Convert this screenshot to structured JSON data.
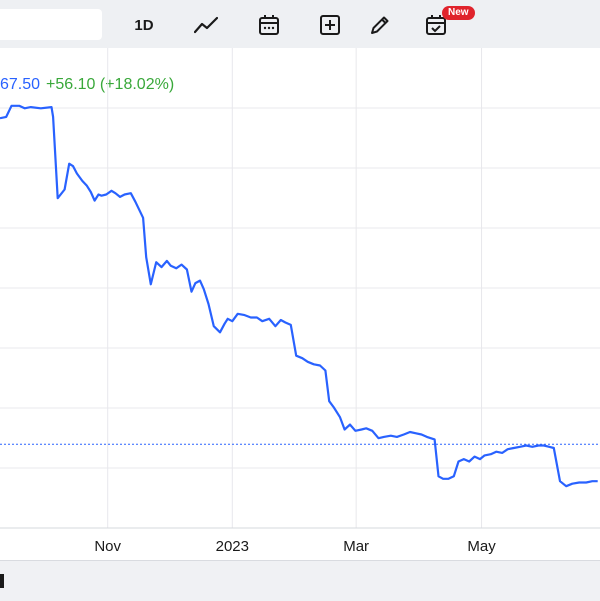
{
  "toolbar": {
    "interval_label": "1D",
    "new_badge": "New",
    "icons": [
      "line-chart-icon",
      "calendar-icon",
      "add-compare-icon",
      "pencil-icon",
      "calendar-check-icon"
    ]
  },
  "price": {
    "value": "67.50",
    "change": "+56.10 (+18.02%)"
  },
  "colors": {
    "line": "#2962ff",
    "positive": "#39a83a",
    "badge": "#e0242c",
    "grid": "#e8e8ec"
  },
  "chart_data": {
    "type": "line",
    "x_tick_labels": [
      "Nov",
      "2023",
      "Mar",
      "May"
    ],
    "grid": true,
    "reference_line": "dotted horizontal",
    "series": [
      {
        "values": [
          {
            "x": 0.0,
            "y": 0.83
          },
          {
            "x": 0.8,
            "y": 0.84
          },
          {
            "x": 1.5,
            "y": 0.93
          },
          {
            "x": 2.5,
            "y": 0.93
          },
          {
            "x": 3.2,
            "y": 0.91
          },
          {
            "x": 4.0,
            "y": 0.92
          },
          {
            "x": 5.3,
            "y": 0.91
          },
          {
            "x": 6.7,
            "y": 0.92
          },
          {
            "x": 6.9,
            "y": 0.84
          },
          {
            "x": 7.5,
            "y": 0.18
          },
          {
            "x": 8.4,
            "y": 0.25
          },
          {
            "x": 9.0,
            "y": 0.46
          },
          {
            "x": 9.5,
            "y": 0.44
          },
          {
            "x": 10.0,
            "y": 0.38
          },
          {
            "x": 10.7,
            "y": 0.32
          },
          {
            "x": 11.3,
            "y": 0.28
          },
          {
            "x": 11.8,
            "y": 0.23
          },
          {
            "x": 12.3,
            "y": 0.16
          },
          {
            "x": 12.8,
            "y": 0.21
          },
          {
            "x": 13.2,
            "y": 0.2
          },
          {
            "x": 13.8,
            "y": 0.21
          },
          {
            "x": 14.5,
            "y": 0.24
          },
          {
            "x": 15.0,
            "y": 0.22
          },
          {
            "x": 15.6,
            "y": 0.19
          },
          {
            "x": 16.2,
            "y": 0.21
          },
          {
            "x": 17.0,
            "y": 0.22
          },
          {
            "x": 17.6,
            "y": 0.15
          },
          {
            "x": 18.6,
            "y": 0.02
          },
          {
            "x": 19.0,
            "y": -0.3
          },
          {
            "x": 19.6,
            "y": -0.52
          },
          {
            "x": 20.3,
            "y": -0.34
          },
          {
            "x": 21.0,
            "y": -0.38
          },
          {
            "x": 21.7,
            "y": -0.33
          },
          {
            "x": 22.2,
            "y": -0.37
          },
          {
            "x": 22.9,
            "y": -0.39
          },
          {
            "x": 23.6,
            "y": -0.36
          },
          {
            "x": 24.3,
            "y": -0.4
          },
          {
            "x": 24.9,
            "y": -0.58
          },
          {
            "x": 25.4,
            "y": -0.51
          },
          {
            "x": 26.0,
            "y": -0.49
          },
          {
            "x": 26.5,
            "y": -0.56
          },
          {
            "x": 27.1,
            "y": -0.68
          },
          {
            "x": 27.8,
            "y": -0.86
          },
          {
            "x": 28.6,
            "y": -0.91
          },
          {
            "x": 29.2,
            "y": -0.84
          },
          {
            "x": 29.6,
            "y": -0.8
          },
          {
            "x": 30.2,
            "y": -0.82
          },
          {
            "x": 30.9,
            "y": -0.76
          },
          {
            "x": 31.8,
            "y": -0.77
          },
          {
            "x": 32.6,
            "y": -0.79
          },
          {
            "x": 33.4,
            "y": -0.79
          },
          {
            "x": 34.1,
            "y": -0.82
          },
          {
            "x": 35.0,
            "y": -0.8
          },
          {
            "x": 35.8,
            "y": -0.86
          },
          {
            "x": 36.5,
            "y": -0.81
          },
          {
            "x": 37.1,
            "y": -0.83
          },
          {
            "x": 37.8,
            "y": -0.85
          },
          {
            "x": 38.5,
            "y": -1.1
          },
          {
            "x": 39.3,
            "y": -1.12
          },
          {
            "x": 40.0,
            "y": -1.15
          },
          {
            "x": 40.8,
            "y": -1.17
          },
          {
            "x": 41.6,
            "y": -1.18
          },
          {
            "x": 42.3,
            "y": -1.22
          },
          {
            "x": 42.8,
            "y": -1.47
          },
          {
            "x": 43.4,
            "y": -1.52
          },
          {
            "x": 44.2,
            "y": -1.6
          },
          {
            "x": 44.8,
            "y": -1.7
          },
          {
            "x": 45.5,
            "y": -1.66
          },
          {
            "x": 46.2,
            "y": -1.71
          },
          {
            "x": 47.0,
            "y": -1.7
          },
          {
            "x": 47.6,
            "y": -1.69
          },
          {
            "x": 48.4,
            "y": -1.71
          },
          {
            "x": 49.2,
            "y": -1.77
          },
          {
            "x": 49.9,
            "y": -1.76
          },
          {
            "x": 50.8,
            "y": -1.75
          },
          {
            "x": 51.6,
            "y": -1.76
          },
          {
            "x": 52.5,
            "y": -1.74
          },
          {
            "x": 53.3,
            "y": -1.72
          },
          {
            "x": 54.0,
            "y": -1.73
          },
          {
            "x": 54.8,
            "y": -1.74
          },
          {
            "x": 55.5,
            "y": -1.76
          },
          {
            "x": 56.5,
            "y": -1.78
          },
          {
            "x": 57.0,
            "y": -2.08
          },
          {
            "x": 57.6,
            "y": -2.1
          },
          {
            "x": 58.3,
            "y": -2.1
          },
          {
            "x": 59.0,
            "y": -2.08
          },
          {
            "x": 59.6,
            "y": -1.96
          },
          {
            "x": 60.3,
            "y": -1.94
          },
          {
            "x": 61.0,
            "y": -1.96
          },
          {
            "x": 61.7,
            "y": -1.92
          },
          {
            "x": 62.4,
            "y": -1.94
          },
          {
            "x": 63.0,
            "y": -1.91
          },
          {
            "x": 63.8,
            "y": -1.9
          },
          {
            "x": 64.5,
            "y": -1.88
          },
          {
            "x": 65.3,
            "y": -1.89
          },
          {
            "x": 66.0,
            "y": -1.86
          },
          {
            "x": 66.8,
            "y": -1.85
          },
          {
            "x": 67.6,
            "y": -1.84
          },
          {
            "x": 68.4,
            "y": -1.83
          },
          {
            "x": 69.2,
            "y": -1.84
          },
          {
            "x": 70.0,
            "y": -1.83
          },
          {
            "x": 70.7,
            "y": -1.83
          },
          {
            "x": 71.4,
            "y": -1.84
          },
          {
            "x": 72.0,
            "y": -1.85
          },
          {
            "x": 72.8,
            "y": -2.12
          },
          {
            "x": 73.6,
            "y": -2.16
          },
          {
            "x": 74.4,
            "y": -2.14
          },
          {
            "x": 75.3,
            "y": -2.13
          },
          {
            "x": 76.2,
            "y": -2.13
          },
          {
            "x": 77.0,
            "y": -2.12
          },
          {
            "x": 77.7,
            "y": -2.12
          }
        ]
      }
    ],
    "x_ticks": [
      {
        "label": "Nov",
        "x": 14.0
      },
      {
        "label": "2023",
        "x": 30.2
      },
      {
        "label": "Mar",
        "x": 46.3
      },
      {
        "label": "May",
        "x": 62.6
      }
    ],
    "reference_y": -1.82,
    "xlim": [
      0.0,
      78.0
    ],
    "ylim": [
      -2.5,
      1.4
    ]
  }
}
